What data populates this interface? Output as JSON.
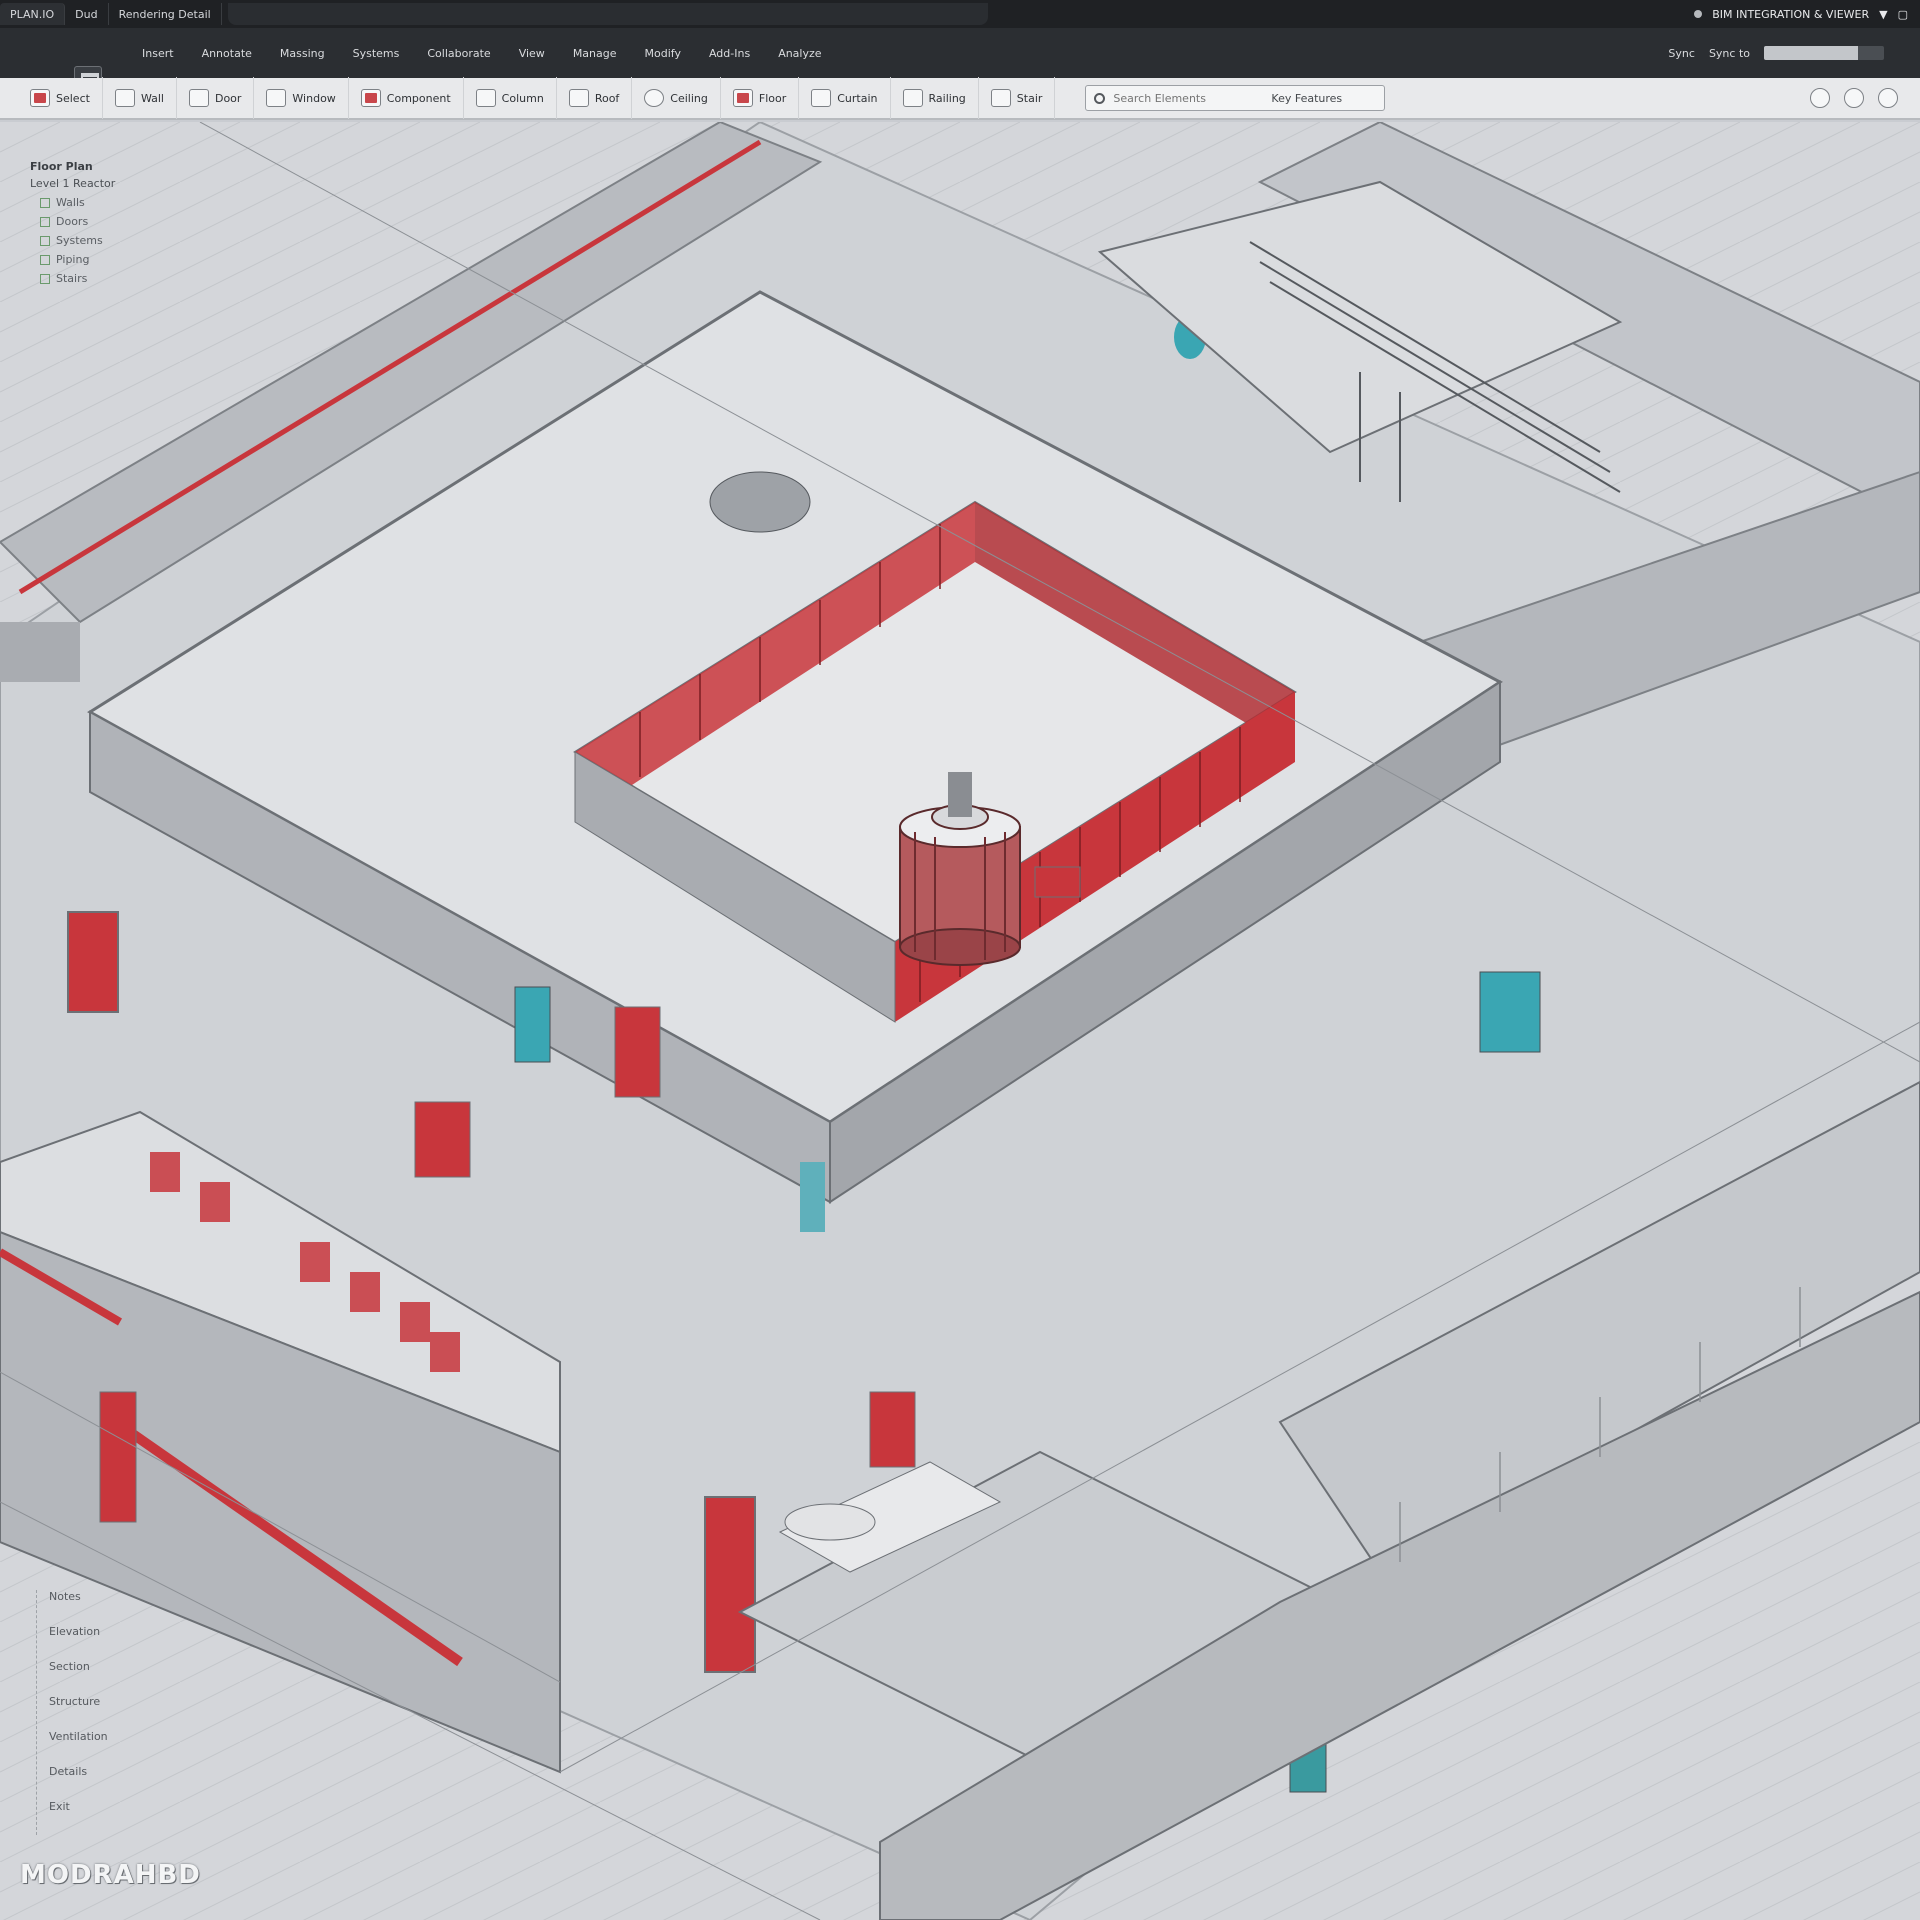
{
  "window": {
    "tabs": [
      "PLAN.IO",
      "Dud",
      "Rendering Detail"
    ],
    "right_status": "BIM INTEGRATION & VIEWER",
    "right_icons": [
      "record-icon",
      "minimize-icon",
      "maximize-icon"
    ]
  },
  "command_bar": {
    "items": [
      "Insert",
      "Annotate",
      "Massing",
      "Systems",
      "Collaborate",
      "View",
      "Manage",
      "Modify",
      "Add-Ins",
      "Analyze"
    ],
    "right_label": "Sync",
    "right_sub": "Sync to",
    "progress": 0.78
  },
  "ribbon": {
    "groups": [
      {
        "label": "Select",
        "icon": "select-icon",
        "accent": true
      },
      {
        "label": "Wall",
        "icon": "wall-icon"
      },
      {
        "label": "Door",
        "icon": "door-icon"
      },
      {
        "label": "Window",
        "icon": "window-icon"
      },
      {
        "label": "Component",
        "icon": "component-icon",
        "accent": true
      },
      {
        "label": "Column",
        "icon": "column-icon"
      },
      {
        "label": "Roof",
        "icon": "roof-icon"
      },
      {
        "label": "Ceiling",
        "icon": "ceiling-icon"
      },
      {
        "label": "Floor",
        "icon": "floor-icon",
        "accent": true
      },
      {
        "label": "Curtain",
        "icon": "curtain-icon"
      },
      {
        "label": "Railing",
        "icon": "railing-icon"
      },
      {
        "label": "Stair",
        "icon": "stair-icon"
      }
    ],
    "search_placeholder": "Search Elements",
    "search_label": "Key Features",
    "right_icons": [
      "help-icon",
      "settings-icon",
      "expand-icon"
    ]
  },
  "layers": {
    "title": "Floor Plan",
    "subtitle": "Level 1 Reactor",
    "items": [
      "Walls",
      "Doors",
      "Systems",
      "Piping",
      "Stairs"
    ]
  },
  "notes": [
    "Notes",
    "Elevation",
    "Section",
    "Structure",
    "Ventilation",
    "Details",
    "Exit"
  ],
  "colors": {
    "accent_red": "#c8363c",
    "accent_teal": "#3aa6b3",
    "wall_gray": "#bfc2c7",
    "floor_gray": "#dfe1e4"
  },
  "watermark": "MODRAHBD"
}
